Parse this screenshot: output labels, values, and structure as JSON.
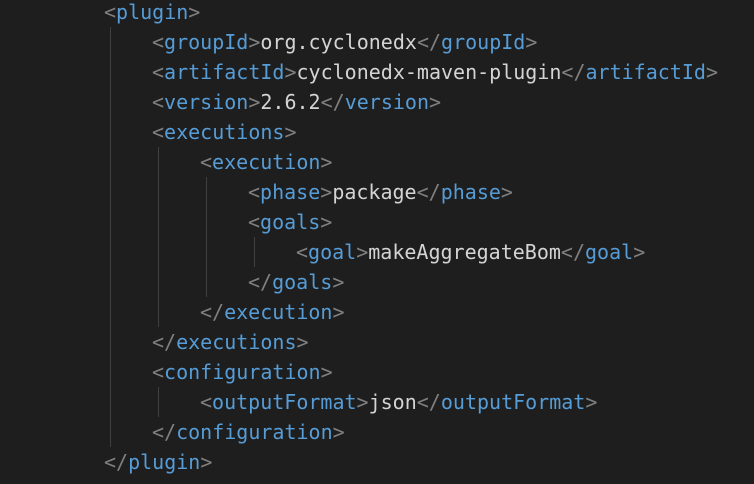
{
  "colors": {
    "background": "#1e1e1e",
    "bracket": "#808080",
    "tag": "#569cd6",
    "text": "#d4d4d4",
    "indent_guide": "#404040"
  },
  "lines": [
    {
      "indent": 2,
      "tag": "plugin",
      "closing": false,
      "text": ""
    },
    {
      "indent": 3,
      "tag": "groupId",
      "closing": false,
      "text": "org.cyclonedx",
      "end_tag": "groupId"
    },
    {
      "indent": 3,
      "tag": "artifactId",
      "closing": false,
      "text": "cyclonedx-maven-plugin",
      "end_tag": "artifactId"
    },
    {
      "indent": 3,
      "tag": "version",
      "closing": false,
      "text": "2.6.2",
      "end_tag": "version"
    },
    {
      "indent": 3,
      "tag": "executions",
      "closing": false,
      "text": ""
    },
    {
      "indent": 4,
      "tag": "execution",
      "closing": false,
      "text": ""
    },
    {
      "indent": 5,
      "tag": "phase",
      "closing": false,
      "text": "package",
      "end_tag": "phase"
    },
    {
      "indent": 5,
      "tag": "goals",
      "closing": false,
      "text": ""
    },
    {
      "indent": 6,
      "tag": "goal",
      "closing": false,
      "text": "makeAggregateBom",
      "end_tag": "goal"
    },
    {
      "indent": 5,
      "tag": "goals",
      "closing": true,
      "text": ""
    },
    {
      "indent": 4,
      "tag": "execution",
      "closing": true,
      "text": ""
    },
    {
      "indent": 3,
      "tag": "executions",
      "closing": true,
      "text": ""
    },
    {
      "indent": 3,
      "tag": "configuration",
      "closing": false,
      "text": ""
    },
    {
      "indent": 4,
      "tag": "outputFormat",
      "closing": false,
      "text": "json",
      "end_tag": "outputFormat"
    },
    {
      "indent": 3,
      "tag": "configuration",
      "closing": true,
      "text": ""
    },
    {
      "indent": 2,
      "tag": "plugin",
      "closing": true,
      "text": ""
    }
  ]
}
